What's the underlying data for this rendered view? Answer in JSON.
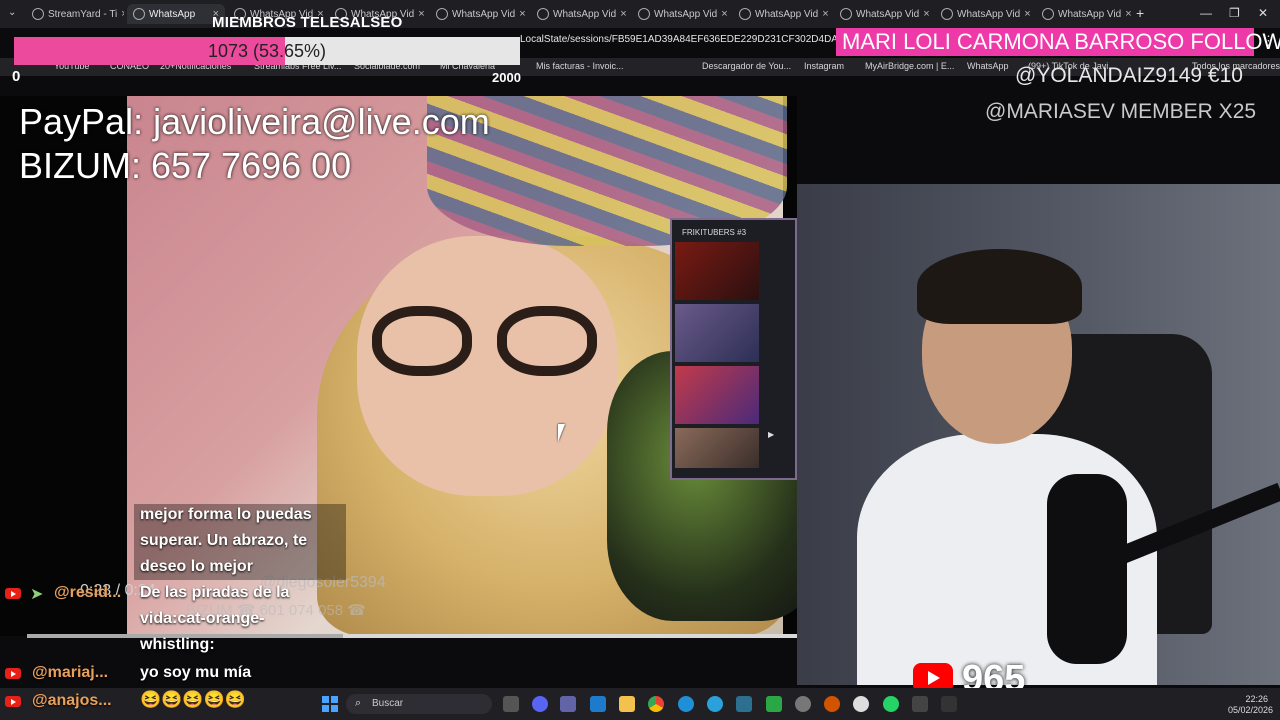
{
  "browser": {
    "tabs": [
      {
        "label": "StreamYard - Ti",
        "active": false
      },
      {
        "label": "WhatsApp",
        "active": true
      },
      {
        "label": "WhatsApp Vid",
        "active": false
      },
      {
        "label": "WhatsApp Vid",
        "active": false
      },
      {
        "label": "WhatsApp Vid",
        "active": false
      },
      {
        "label": "WhatsApp Vid",
        "active": false
      },
      {
        "label": "WhatsApp Vid",
        "active": false
      },
      {
        "label": "WhatsApp Vid",
        "active": false
      },
      {
        "label": "WhatsApp Vid",
        "active": false
      },
      {
        "label": "WhatsApp Vid",
        "active": false
      },
      {
        "label": "WhatsApp Vid",
        "active": false
      }
    ],
    "new_tab": "+",
    "url": "LocalState/sessions/FB59E1AD39A84EF636EDE229D231CF302D4DACC2/trans",
    "bookmarks": [
      "YouTube",
      "CONAEO",
      "20+Notificaciones",
      "Streamlabs Free Liv...",
      "Socialblade.com",
      "Mi Chavaleria",
      "Mis facturas - Invoic...",
      "Descargador de You...",
      "Instagram",
      "MyAirBridge.com | E...",
      "WhatsApp",
      "(99+) TikTok de Javi...",
      "Todos los marcadores"
    ]
  },
  "overlay": {
    "members_title": "MIEMBROS TELESALSEO",
    "goal_text": "1073 (53.65%)",
    "goal_progress": 0.5365,
    "goal_min": "0",
    "goal_max": "2000",
    "follow_banner": "MARI LOLI CARMONA BARROSO  FOLLOW",
    "last_donation": "@YOLANDAIZ9149  €10",
    "last_member": "@MARIASEV   MEMBER X25",
    "payment_lines": [
      "PayPal: javioliveira@live.com",
      "BIZUM: 657 7696 00"
    ],
    "mini_panel_title": "FRIKITUBERS #3"
  },
  "player": {
    "time": "0:23 / 0:24",
    "progress": 0.41,
    "ghost_user": "@diegosoler5394",
    "ghost_line": "BIZUM ☎ 601 074 058 ☎"
  },
  "chat": {
    "block1": [
      "mejor forma lo puedas",
      "superar. Un abrazo, te",
      "deseo lo mejor"
    ],
    "msg2_user": "@resid...",
    "msg2_lines": [
      "De las piradas de la",
      "vida:cat-orange-",
      "whistling:"
    ],
    "msg3_user": "@mariaj...",
    "msg3_text": "yo soy mu mía",
    "msg4_user": "@anajos...",
    "msg4_text": "😆😆😆😆😆"
  },
  "youtube": {
    "live_count": "965"
  },
  "taskbar": {
    "search_placeholder": "Buscar",
    "time": "22:26",
    "date": "05/02/2026"
  },
  "colors": {
    "goal_fill": "#ec4a9c",
    "follow_bg": "#ee3aa8",
    "chat_user": "#e8a05a",
    "youtube_red": "#ff0000"
  }
}
